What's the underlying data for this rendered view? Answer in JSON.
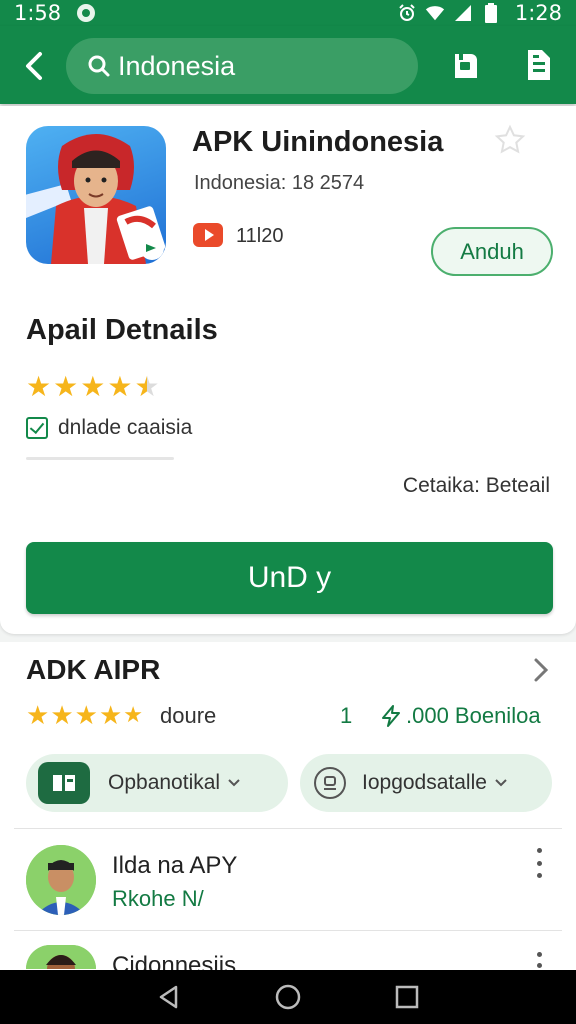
{
  "status_bar": {
    "time_left": "1:58",
    "time_right": "1:28"
  },
  "search": {
    "query": "Indonesia"
  },
  "app": {
    "title": "APK Uinindonesia",
    "subtitle": "Indonesia: 18 2574",
    "video_count": "11l20",
    "install_label": "Anduh"
  },
  "details": {
    "section_title": "Apail Detnails",
    "rating": 4.5,
    "checkbox_label": "dnlade caaisia",
    "details_link": "Cetaika: Beteail",
    "primary_button": "UnD y"
  },
  "apk_section": {
    "title": "ADK AIPR",
    "rating": 4.5,
    "rating_label": "doure",
    "count": "1",
    "downloads": ".000 Boeniloa",
    "chips": [
      {
        "label": "Opbanotikal"
      },
      {
        "label": "Iopgodsatalle"
      }
    ],
    "list": [
      {
        "title": "Ilda na APY",
        "subtitle": "Rkohe N/"
      },
      {
        "title": "Cidonnesiis"
      }
    ]
  },
  "colors": {
    "brand_green": "#13894a",
    "star_gold": "#f6b51b",
    "youtube_red": "#ea4a2a"
  }
}
